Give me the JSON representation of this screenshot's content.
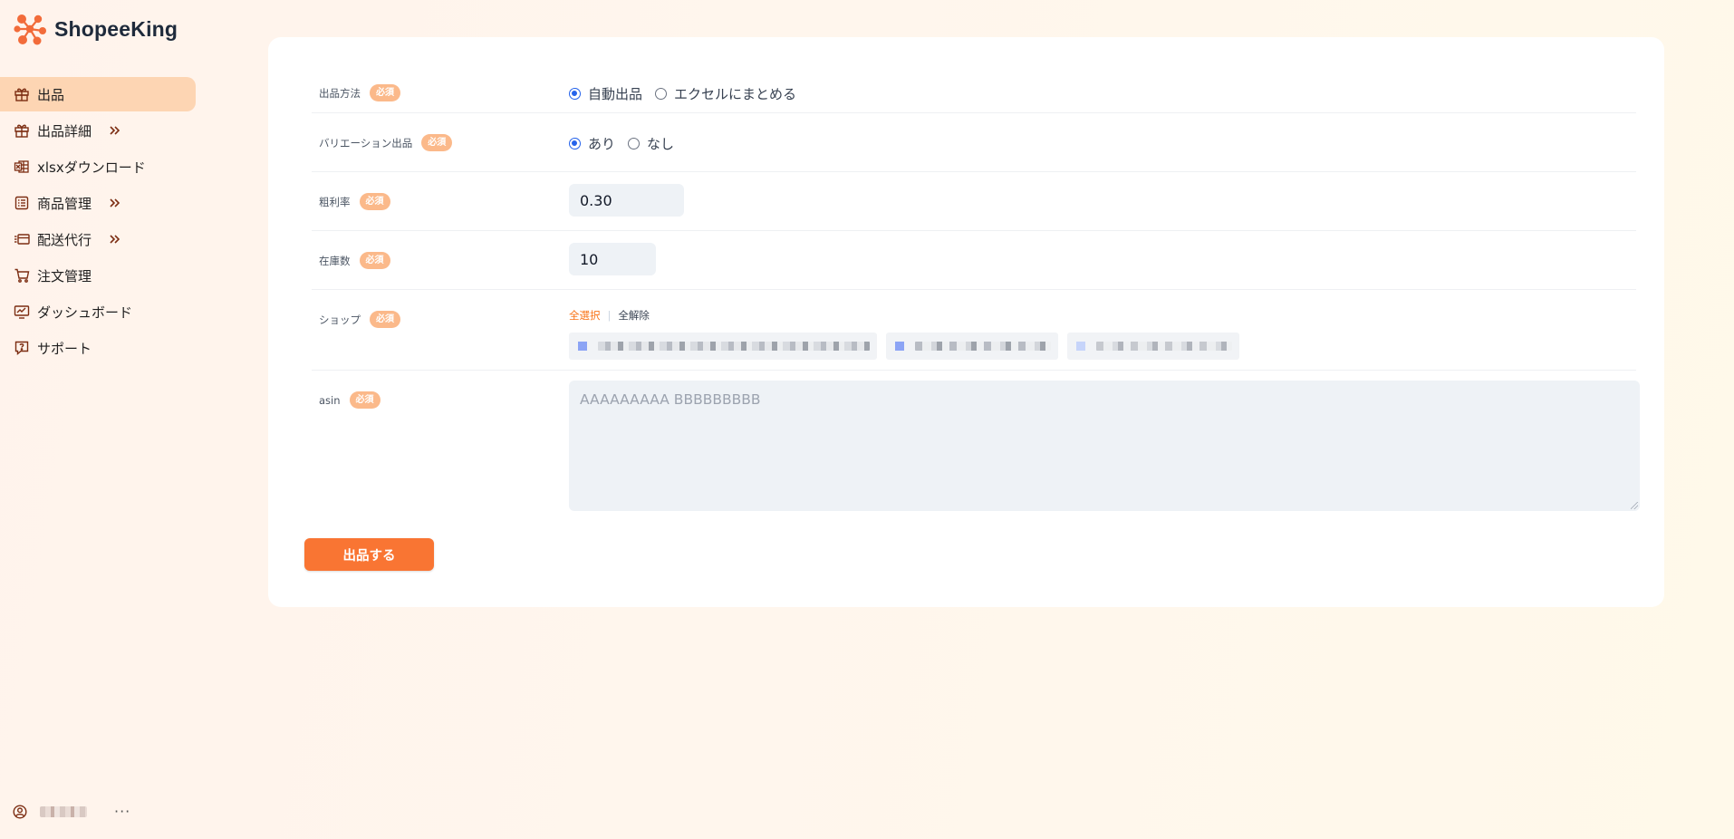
{
  "brand": {
    "name": "ShopeeKing",
    "accent": "#f97533"
  },
  "sidebar": {
    "items": [
      {
        "label": "出品",
        "icon": "gift-icon",
        "active": true,
        "expandable": false
      },
      {
        "label": "出品詳細",
        "icon": "gift-icon",
        "active": false,
        "expandable": true
      },
      {
        "label": "xlsxダウンロード",
        "icon": "excel-icon",
        "active": false,
        "expandable": false
      },
      {
        "label": "商品管理",
        "icon": "list-icon",
        "active": false,
        "expandable": true
      },
      {
        "label": "配送代行",
        "icon": "shipping-icon",
        "active": false,
        "expandable": true
      },
      {
        "label": "注文管理",
        "icon": "cart-icon",
        "active": false,
        "expandable": false
      },
      {
        "label": "ダッシュボード",
        "icon": "dashboard-icon",
        "active": false,
        "expandable": false
      },
      {
        "label": "サポート",
        "icon": "support-icon",
        "active": false,
        "expandable": false
      }
    ],
    "user": {
      "more": "···"
    }
  },
  "form": {
    "required_badge": "必須",
    "method": {
      "label": "出品方法",
      "options": [
        "自動出品",
        "エクセルにまとめる"
      ],
      "selected": 0
    },
    "variation": {
      "label": "バリエーション出品",
      "options": [
        "あり",
        "なし"
      ],
      "selected": 0
    },
    "margin": {
      "label": "粗利率",
      "value": "0.30"
    },
    "stock": {
      "label": "在庫数",
      "value": "10"
    },
    "shop": {
      "label": "ショップ",
      "select_all": "全選択",
      "separator": "|",
      "clear_all": "全解除"
    },
    "asin": {
      "label": "asin",
      "placeholder": "AAAAAAAAA BBBBBBBBB"
    },
    "submit": "出品する"
  }
}
